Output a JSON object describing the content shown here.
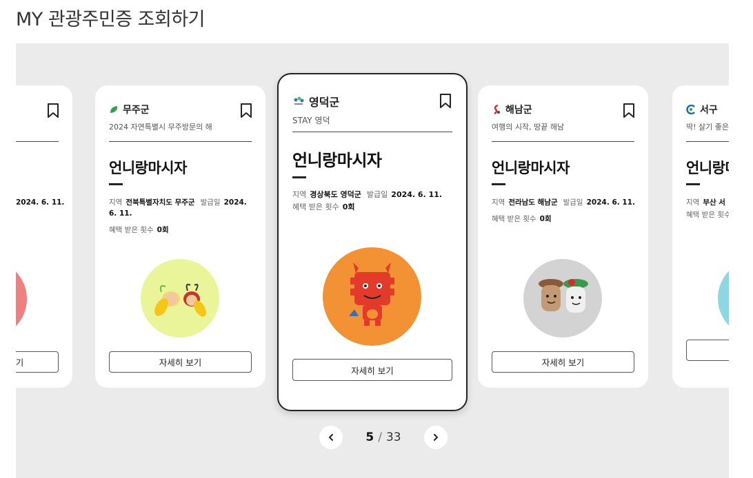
{
  "page": {
    "title": "MY 관광주민증 조회하기"
  },
  "common": {
    "card_title": "언니랑마시자",
    "region_label": "지역",
    "issue_label": "발급일",
    "benefit_label": "혜택 받은 횟수",
    "detail_button": "자세히 보기"
  },
  "cards": [
    {
      "region": "",
      "slogan": "",
      "region_full": "",
      "issue_date": "2024. 6. 11.",
      "benefit_count": "",
      "colors": {
        "mascot_bg": "#f08080",
        "logo": "#888888"
      }
    },
    {
      "region": "무주군",
      "slogan": "2024 자연특별시 무주방문의 해",
      "region_full": "전북특별자치도 무주군",
      "issue_date": "2024. 6. 11.",
      "benefit_count": "0회",
      "colors": {
        "mascot_bg": "#eaf59a",
        "logo": "#2aa34a"
      }
    },
    {
      "region": "영덕군",
      "slogan": "STAY 영덕",
      "region_full": "경상북도 영덕군",
      "issue_date": "2024. 6. 11.",
      "benefit_count": "0회",
      "colors": {
        "mascot_bg": "#f29235",
        "logo": "#2b7bbd"
      }
    },
    {
      "region": "해남군",
      "slogan": "여행의 시작, 땅끝 해남",
      "region_full": "전라남도 해남군",
      "issue_date": "2024. 6. 11.",
      "benefit_count": "0회",
      "colors": {
        "mascot_bg": "#d3d3d3",
        "logo": "#d62b2b"
      }
    },
    {
      "region": "서구",
      "slogan": "딱! 살기 좋은",
      "region_full": "부산 서",
      "issue_date": "",
      "benefit_count": "",
      "colors": {
        "mascot_bg": "#8fd6e4",
        "logo": "#1c6bb5"
      }
    }
  ],
  "pager": {
    "current": "5",
    "separator": "/",
    "total": "33",
    "prev_icon": "chevron-left-icon",
    "next_icon": "chevron-right-icon"
  }
}
